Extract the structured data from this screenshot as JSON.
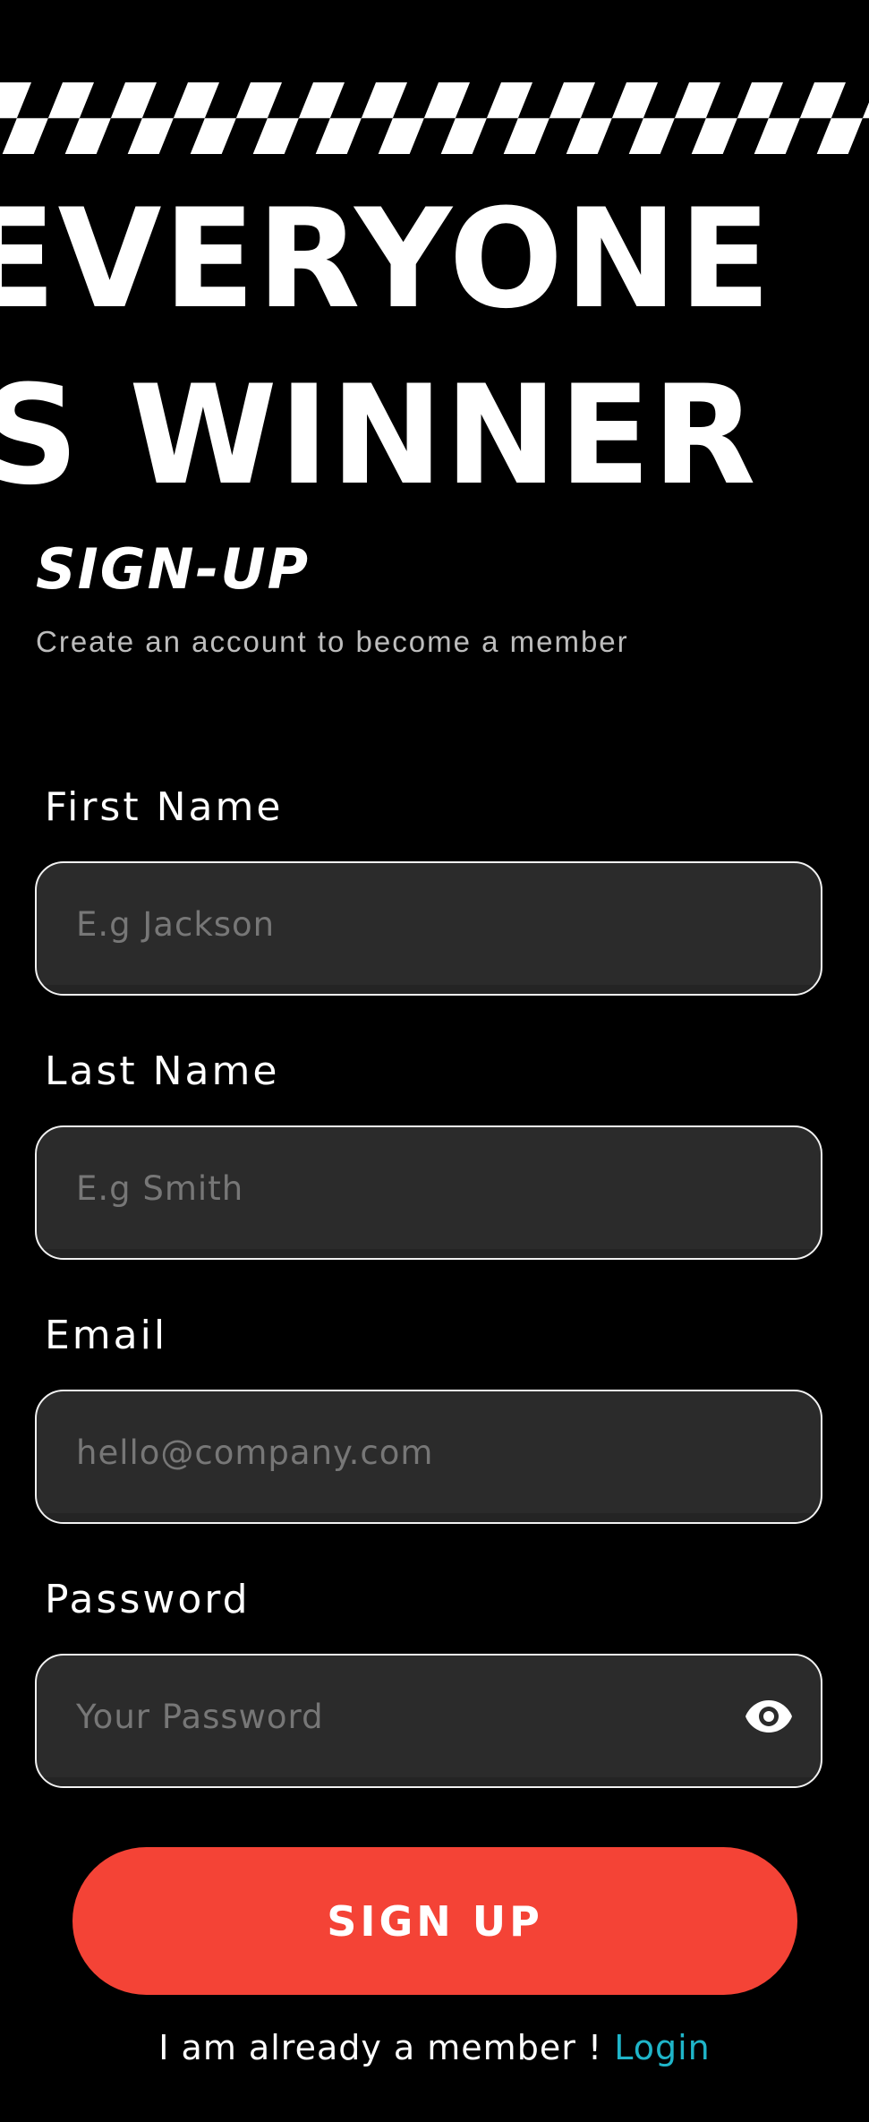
{
  "hero": {
    "line1": "EVERYONE",
    "line2": "S WINNER"
  },
  "title": "SIGN-UP",
  "subtitle": "Create an account to become a member",
  "fields": [
    {
      "label": "First Name",
      "placeholder": "E.g Jackson",
      "value": "",
      "type": "text"
    },
    {
      "label": "Last Name",
      "placeholder": "E.g Smith",
      "value": "",
      "type": "text"
    },
    {
      "label": "Email",
      "placeholder": "hello@company.com",
      "value": "",
      "type": "email"
    },
    {
      "label": "Password",
      "placeholder": "Your Password",
      "value": "",
      "type": "password",
      "icon": "eye-icon"
    }
  ],
  "signup_button": "SIGN UP",
  "footer": {
    "text": "I am already a member ! ",
    "link": "Login"
  },
  "colors": {
    "background": "#000000",
    "input_background": "#2b2b2b",
    "button": "#f44336",
    "link": "#1fb5c9"
  }
}
